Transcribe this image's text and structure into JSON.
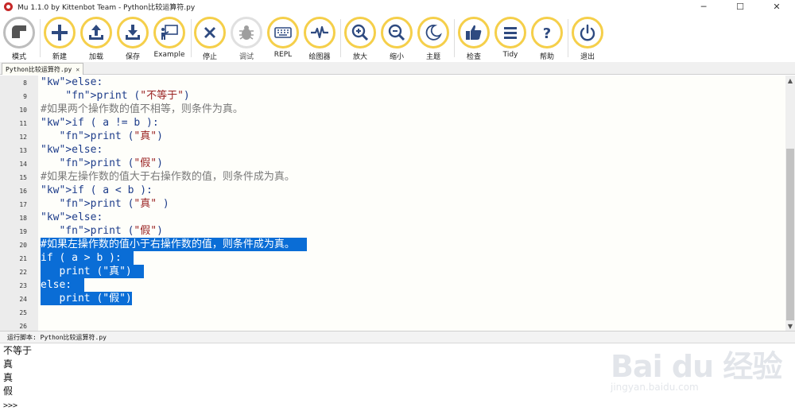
{
  "window": {
    "title": "Mu 1.1.0 by Kittenbot Team - Python比较运算符.py",
    "minimize": "─",
    "maximize": "☐",
    "close": "✕"
  },
  "toolbar": {
    "mode": "模式",
    "new": "新建",
    "load": "加载",
    "save": "保存",
    "example": "Example",
    "stop": "停止",
    "debug": "调试",
    "repl": "REPL",
    "plotter": "绘图器",
    "zoom_in": "放大",
    "zoom_out": "缩小",
    "theme": "主题",
    "check": "检查",
    "tidy": "Tidy",
    "help": "帮助",
    "quit": "退出"
  },
  "colors": {
    "toolbar_ring": "#f5cf4a",
    "selection": "#0a6dd6",
    "editor_bg": "#fefefa"
  },
  "tab": {
    "name": "Python比较运算符.py",
    "close": "✕"
  },
  "editor": {
    "lines": [
      {
        "num": "8",
        "code": "else:"
      },
      {
        "num": "9",
        "code": "    print (\"不等于\")"
      },
      {
        "num": "10",
        "code": "#如果两个操作数的值不相等，则条件为真。"
      },
      {
        "num": "11",
        "code": "if ( a != b ):"
      },
      {
        "num": "12",
        "code": "   print (\"真\")"
      },
      {
        "num": "13",
        "code": "else:"
      },
      {
        "num": "14",
        "code": "   print (\"假\")"
      },
      {
        "num": "15",
        "code": "#如果左操作数的值大于右操作数的值，则条件成为真。"
      },
      {
        "num": "16",
        "code": "if ( a < b ):"
      },
      {
        "num": "17",
        "code": "   print (\"真\" )"
      },
      {
        "num": "18",
        "code": "else:"
      },
      {
        "num": "19",
        "code": "   print (\"假\")"
      },
      {
        "num": "20",
        "code": "#如果左操作数的值小于右操作数的值，则条件成为真。"
      },
      {
        "num": "21",
        "code": "if ( a > b ):"
      },
      {
        "num": "22",
        "code": "   print (\"真\")"
      },
      {
        "num": "23",
        "code": "else:"
      },
      {
        "num": "24",
        "code": "   print (\"假\")"
      },
      {
        "num": "25",
        "code": ""
      },
      {
        "num": "26",
        "code": ""
      }
    ]
  },
  "runner": {
    "label": "运行脚本: Python比较运算符.py",
    "output": [
      "不等于",
      "真",
      "真",
      "假"
    ],
    "prompt": ">>>"
  },
  "watermark": {
    "brand": "Bai du 经验",
    "sub": "jingyan.baidu.com"
  }
}
